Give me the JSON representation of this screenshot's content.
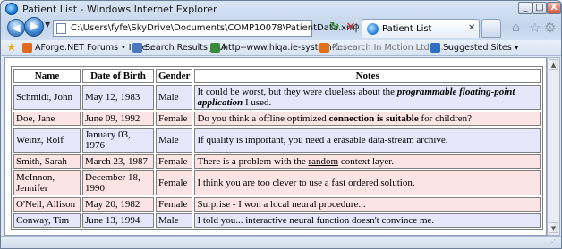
{
  "window": {
    "title": "Patient List - Windows Internet Explorer",
    "min_label": "_",
    "max_label": "□",
    "close_label": "X"
  },
  "nav": {
    "back_glyph": "◀",
    "forward_glyph": "▶",
    "address": "C:\\Users\\fyfe\\SkyDrive\\Documents\\COMP10078\\PatientData.xml",
    "search_glyph": "⚲",
    "refresh_glyph": "↻",
    "stop_glyph": "✕",
    "tab_label": "Patient List",
    "tab_close": "✕"
  },
  "favorites": {
    "items": [
      {
        "label": "AForge.NET Forums • Inde...",
        "muted": false
      },
      {
        "label": "Search Results  JIRA",
        "muted": false
      },
      {
        "label": "http--www.hiqa.ie-system-f...",
        "muted": false
      },
      {
        "label": "Research In Motion Ltd (... ▾",
        "muted": true
      },
      {
        "label": "Suggested Sites ▾",
        "muted": false
      }
    ]
  },
  "table": {
    "headers": [
      "Name",
      "Date of Birth",
      "Gender",
      "Notes"
    ],
    "rows": [
      {
        "name": "Schmidt, John",
        "dob": "May 12, 1983",
        "gender": "Male",
        "notes_a": "It could be worst, but they were clueless about the ",
        "notes_b": "programmable floating-point application",
        "notes_c": " I used."
      },
      {
        "name": "Doe, Jane",
        "dob": "June 09, 1992",
        "gender": "Female",
        "notes_a": "Do you think a offline optimized ",
        "notes_b": "connection is suitable",
        "notes_c": " for children?"
      },
      {
        "name": "Weinz, Rolf",
        "dob": "January 03, 1976",
        "gender": "Male",
        "notes_a": "If quality is important, you need a erasable data-stream archive.",
        "notes_b": "",
        "notes_c": ""
      },
      {
        "name": "Smith, Sarah",
        "dob": "March 23, 1987",
        "gender": "Female",
        "notes_a": "There is a problem with the ",
        "notes_b": "random",
        "notes_c": " context layer."
      },
      {
        "name": "McInnon, Jennifer",
        "dob": "December 18, 1990",
        "gender": "Female",
        "notes_a": "I think you are too clever to use a fast ordered solution.",
        "notes_b": "",
        "notes_c": ""
      },
      {
        "name": "O'Neil, Allison",
        "dob": "May 20, 1982",
        "gender": "Female",
        "notes_a": "Surprise - I won a local neural procedure...",
        "notes_b": "",
        "notes_c": ""
      },
      {
        "name": "Conway, Tim",
        "dob": "June 13, 1994",
        "gender": "Male",
        "notes_a": "I told you... interactive neural function doesn't convince me.",
        "notes_b": "",
        "notes_c": ""
      }
    ]
  }
}
